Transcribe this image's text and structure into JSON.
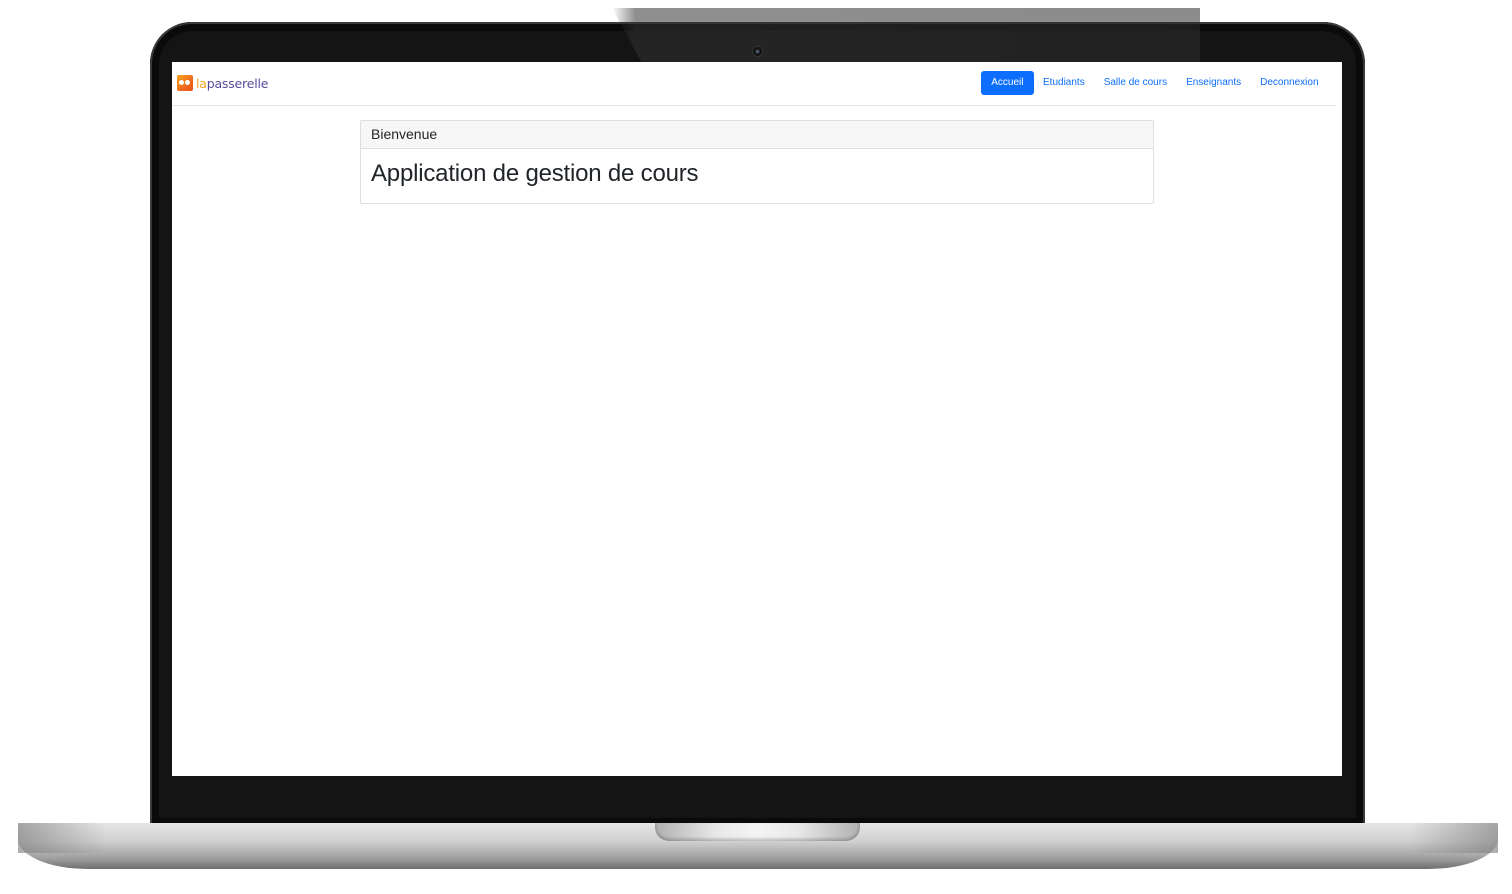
{
  "brand": {
    "logo_icon": "lapasserelle-logo-icon",
    "name_prefix": "la",
    "name_rest": "passerelle"
  },
  "nav": {
    "items": [
      {
        "label": "Accueil",
        "active": true
      },
      {
        "label": "Etudiants",
        "active": false
      },
      {
        "label": "Salle de cours",
        "active": false
      },
      {
        "label": "Enseignants",
        "active": false
      },
      {
        "label": "Deconnexion",
        "active": false
      }
    ]
  },
  "card": {
    "header": "Bienvenue",
    "title": "Application de gestion de cours"
  },
  "colors": {
    "primary": "#0d6efd",
    "brand_orange": "#f5a623",
    "brand_purple": "#5b4a9a"
  }
}
